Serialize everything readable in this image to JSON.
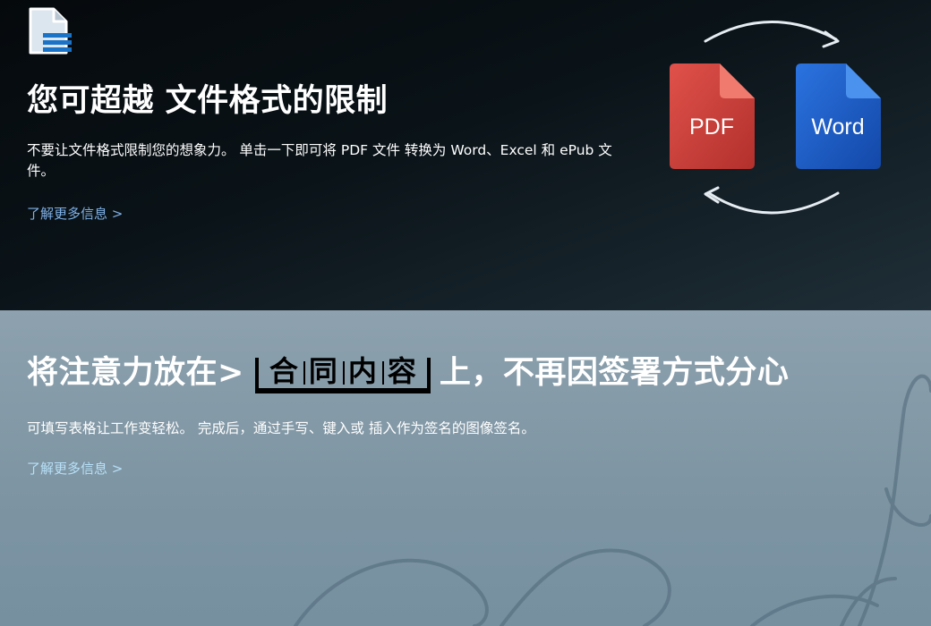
{
  "feature1": {
    "title": "您可超越 文件格式的限制",
    "description": "不要让文件格式限制您的想象力。 单击一下即可将 PDF 文件 转换为 Word、Excel 和 ePub 文件。",
    "link": "了解更多信息 >",
    "graphic": {
      "source_label": "PDF",
      "target_label": "Word",
      "source_color": "#d2403a",
      "target_color": "#1d5fd0"
    }
  },
  "feature2": {
    "title_prefix": "将注意力放在>",
    "title_highlight": [
      "合",
      "同",
      "内",
      "容"
    ],
    "title_suffix": "上，不再因签署方式分心",
    "description": "可填写表格让工作变轻松。 完成后，通过手写、键入或 插入作为签名的图像签名。",
    "link": "了解更多信息 >"
  },
  "icons": {
    "doc": "document-icon",
    "arrow": "curved-arrow-icon"
  },
  "colors": {
    "link_top": "#7fb0e6",
    "link_bottom": "#b7e0f7",
    "bottom_bg": "#8297a5"
  }
}
